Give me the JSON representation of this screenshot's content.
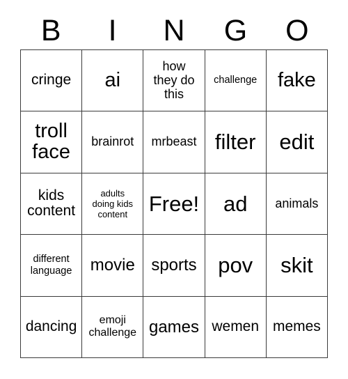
{
  "card": {
    "title": "BINGO",
    "headers": [
      "B",
      "I",
      "N",
      "G",
      "O"
    ],
    "free_space_label": "Free!",
    "colors": {
      "background": "#ffffff",
      "text": "#000000",
      "grid_line": "#3b3b3b"
    },
    "rows": [
      [
        {
          "text": "cringe",
          "size": "ml"
        },
        {
          "text": "ai",
          "size": "xl"
        },
        {
          "text": "how\nthey do\nthis",
          "size": "m"
        },
        {
          "text": "challenge",
          "size": "s"
        },
        {
          "text": "fake",
          "size": "xl"
        }
      ],
      [
        {
          "text": "troll\nface",
          "size": "xl"
        },
        {
          "text": "brainrot",
          "size": "m"
        },
        {
          "text": "mrbeast",
          "size": "m"
        },
        {
          "text": "filter",
          "size": "xxl"
        },
        {
          "text": "edit",
          "size": "xxl"
        }
      ],
      [
        {
          "text": "kids\ncontent",
          "size": "ml"
        },
        {
          "text": "adults\ndoing kids\ncontent",
          "size": "xs"
        },
        {
          "text": "Free!",
          "size": "xxl"
        },
        {
          "text": "ad",
          "size": "xxl"
        },
        {
          "text": "animals",
          "size": "m"
        }
      ],
      [
        {
          "text": "different\nlanguage",
          "size": "s"
        },
        {
          "text": "movie",
          "size": "l"
        },
        {
          "text": "sports",
          "size": "l"
        },
        {
          "text": "pov",
          "size": "xxl"
        },
        {
          "text": "skit",
          "size": "xxl"
        }
      ],
      [
        {
          "text": "dancing",
          "size": "ml"
        },
        {
          "text": "emoji\nchallenge",
          "size": "sm"
        },
        {
          "text": "games",
          "size": "l"
        },
        {
          "text": "wemen",
          "size": "ml"
        },
        {
          "text": "memes",
          "size": "ml"
        }
      ]
    ]
  }
}
